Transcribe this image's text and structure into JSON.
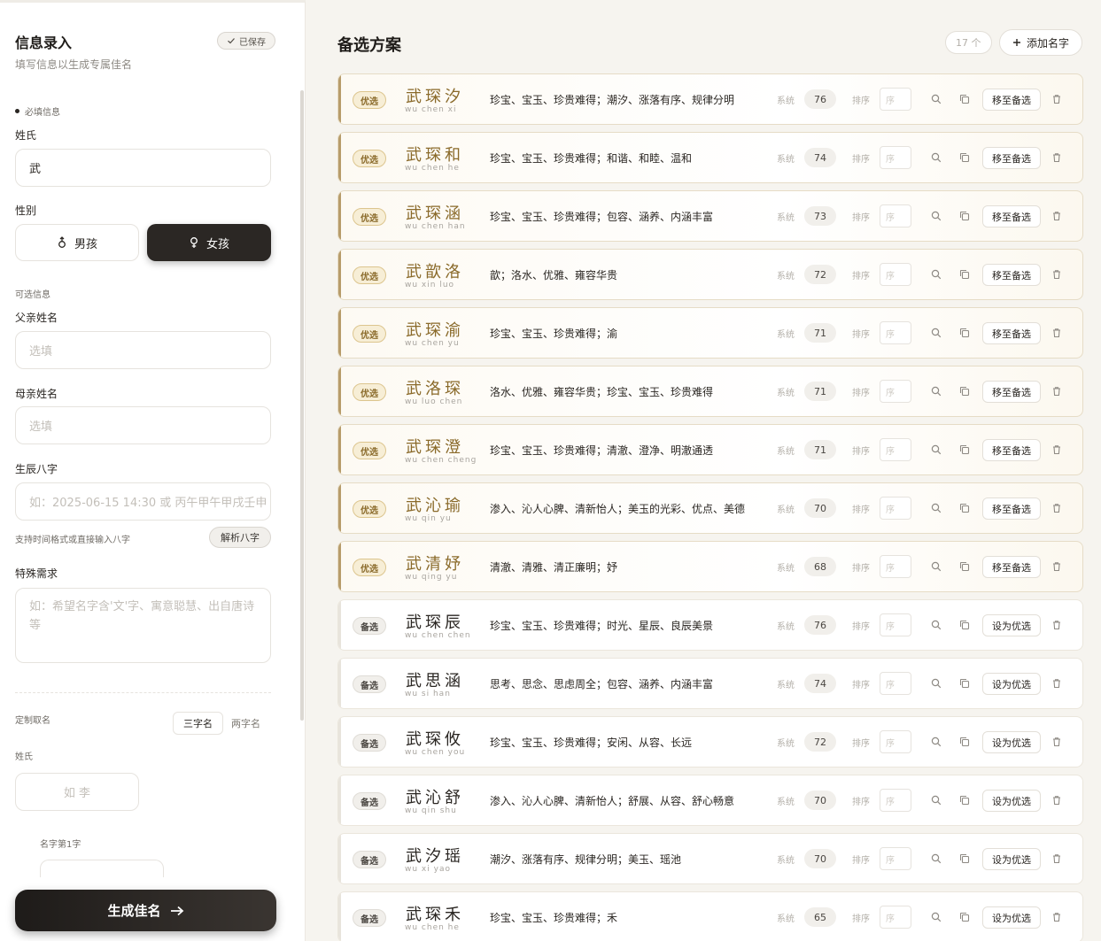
{
  "sidebar": {
    "title": "信息录入",
    "subtitle": "填写信息以生成专属佳名",
    "saved_label": "已保存",
    "required_section": "必填信息",
    "surname_label": "姓氏",
    "surname_value": "武",
    "gender_label": "性别",
    "gender_male": "男孩",
    "gender_female": "女孩",
    "gender_selected": "女孩",
    "optional_section": "可选信息",
    "father_label": "父亲姓名",
    "father_placeholder": "选填",
    "mother_label": "母亲姓名",
    "mother_placeholder": "选填",
    "bazi_label": "生辰八字",
    "bazi_placeholder": "如：2025-06-15 14:30 或 丙午甲午甲戌壬申",
    "bazi_hint": "支持时间格式或直接输入八字",
    "parse_button": "解析八字",
    "special_label": "特殊需求",
    "special_placeholder": "如：希望名字含'文'字、寓意聪慧、出自唐诗等",
    "custom_section": "定制取名",
    "three_char": "三字名",
    "two_char": "两字名",
    "custom_surname_label": "姓氏",
    "custom_surname_placeholder": "如 李",
    "first_char_label": "名字第1字",
    "generate_button": "生成佳名"
  },
  "main": {
    "title": "备选方案",
    "count": "17 个",
    "add_button": "添加名字",
    "sys_label": "系统",
    "order_label": "排序",
    "order_placeholder": "序",
    "rows": [
      {
        "status": "pref",
        "tag": "优选",
        "name": "武琛汐",
        "pinyin": "wu chen xi",
        "meaning": "珍宝、宝玉、珍贵难得；潮汐、涨落有序、规律分明",
        "score": "76",
        "action": "移至备选"
      },
      {
        "status": "pref",
        "tag": "优选",
        "name": "武琛和",
        "pinyin": "wu chen he",
        "meaning": "珍宝、宝玉、珍贵难得；和谐、和睦、温和",
        "score": "74",
        "action": "移至备选"
      },
      {
        "status": "pref",
        "tag": "优选",
        "name": "武琛涵",
        "pinyin": "wu chen han",
        "meaning": "珍宝、宝玉、珍贵难得；包容、涵养、内涵丰富",
        "score": "73",
        "action": "移至备选"
      },
      {
        "status": "pref",
        "tag": "优选",
        "name": "武歆洛",
        "pinyin": "wu xin luo",
        "meaning": "歆；洛水、优雅、雍容华贵",
        "score": "72",
        "action": "移至备选"
      },
      {
        "status": "pref",
        "tag": "优选",
        "name": "武琛渝",
        "pinyin": "wu chen yu",
        "meaning": "珍宝、宝玉、珍贵难得；渝",
        "score": "71",
        "action": "移至备选"
      },
      {
        "status": "pref",
        "tag": "优选",
        "name": "武洛琛",
        "pinyin": "wu luo chen",
        "meaning": "洛水、优雅、雍容华贵；珍宝、宝玉、珍贵难得",
        "score": "71",
        "action": "移至备选"
      },
      {
        "status": "pref",
        "tag": "优选",
        "name": "武琛澄",
        "pinyin": "wu chen cheng",
        "meaning": "珍宝、宝玉、珍贵难得；清澈、澄净、明澈通透",
        "score": "71",
        "action": "移至备选"
      },
      {
        "status": "pref",
        "tag": "优选",
        "name": "武沁瑜",
        "pinyin": "wu qin yu",
        "meaning": "渗入、沁人心脾、清新怡人；美玉的光彩、优点、美德",
        "score": "70",
        "action": "移至备选"
      },
      {
        "status": "pref",
        "tag": "优选",
        "name": "武清妤",
        "pinyin": "wu qing yu",
        "meaning": "清澈、清雅、清正廉明；妤",
        "score": "68",
        "action": "移至备选"
      },
      {
        "status": "alt",
        "tag": "备选",
        "name": "武琛辰",
        "pinyin": "wu chen chen",
        "meaning": "珍宝、宝玉、珍贵难得；时光、星辰、良辰美景",
        "score": "76",
        "action": "设为优选"
      },
      {
        "status": "alt",
        "tag": "备选",
        "name": "武思涵",
        "pinyin": "wu si han",
        "meaning": "思考、思念、思虑周全；包容、涵养、内涵丰富",
        "score": "74",
        "action": "设为优选"
      },
      {
        "status": "alt",
        "tag": "备选",
        "name": "武琛攸",
        "pinyin": "wu chen you",
        "meaning": "珍宝、宝玉、珍贵难得；安闲、从容、长远",
        "score": "72",
        "action": "设为优选"
      },
      {
        "status": "alt",
        "tag": "备选",
        "name": "武沁舒",
        "pinyin": "wu qin shu",
        "meaning": "渗入、沁人心脾、清新怡人；舒展、从容、舒心畅意",
        "score": "70",
        "action": "设为优选"
      },
      {
        "status": "alt",
        "tag": "备选",
        "name": "武汐瑶",
        "pinyin": "wu xi yao",
        "meaning": "潮汐、涨落有序、规律分明；美玉、瑶池",
        "score": "70",
        "action": "设为优选"
      },
      {
        "status": "alt",
        "tag": "备选",
        "name": "武琛禾",
        "pinyin": "wu chen he",
        "meaning": "珍宝、宝玉、珍贵难得；禾",
        "score": "65",
        "action": "设为优选"
      }
    ]
  },
  "colors": {
    "accent_gold": "#b79c6a",
    "dark_button": "#2b2724",
    "preferred_tag_bg": "#f7eed6"
  },
  "icons": [
    "check-icon",
    "male-icon",
    "female-icon",
    "plus-icon",
    "search-icon",
    "copy-icon",
    "trash-icon",
    "arrow-right-icon"
  ]
}
